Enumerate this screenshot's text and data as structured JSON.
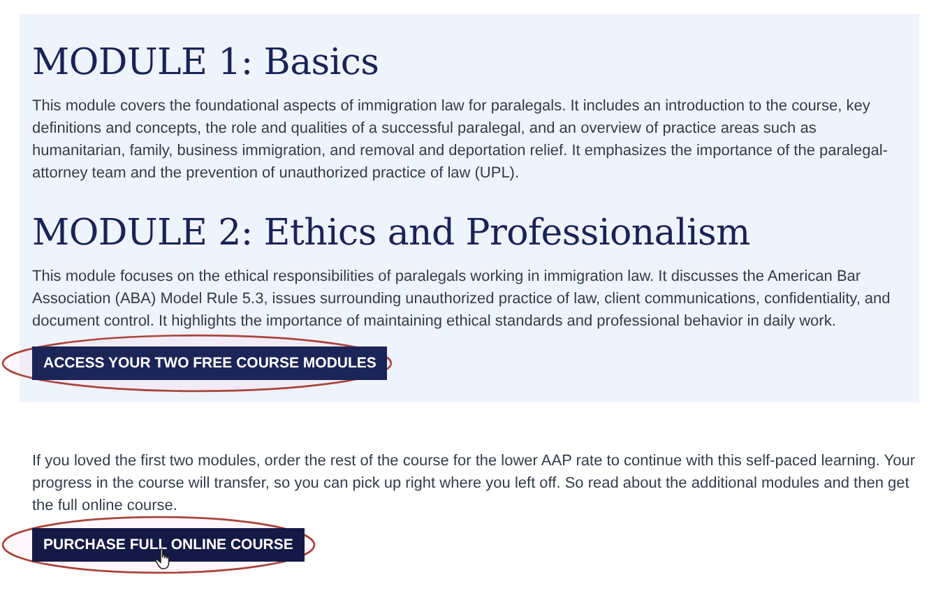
{
  "modules": [
    {
      "title": "MODULE 1: Basics",
      "description": "This module covers the foundational aspects of immigration law for paralegals. It includes an introduction to the course, key definitions and concepts, the role and qualities of a successful paralegal, and an overview of practice areas such as humanitarian, family, business immigration, and removal and deportation relief. It emphasizes the importance of the paralegal-attorney team and the prevention of unauthorized practice of law (UPL)."
    },
    {
      "title": "MODULE 2: Ethics and Professionalism",
      "description": "This module focuses on the ethical responsibilities of paralegals working in immigration law. It discusses the American Bar Association (ABA) Model Rule 5.3, issues surrounding unauthorized practice of law, client communications, confidentiality, and document control. It highlights the importance of maintaining ethical standards and professional behavior in daily work."
    }
  ],
  "access_button": {
    "label": "ACCESS YOUR TWO FREE COURSE MODULES",
    "highlighted": true
  },
  "purchase_text": "If you loved the first two modules, order the rest of the course for the lower AAP rate to continue with this self-paced learning. Your progress in the course will transfer, so you can pick up right where you left off. So read about the additional modules and then get the full online course.",
  "purchase_button": {
    "label": "PURCHASE FULL ONLINE COURSE",
    "highlighted": true,
    "hovered": true
  }
}
